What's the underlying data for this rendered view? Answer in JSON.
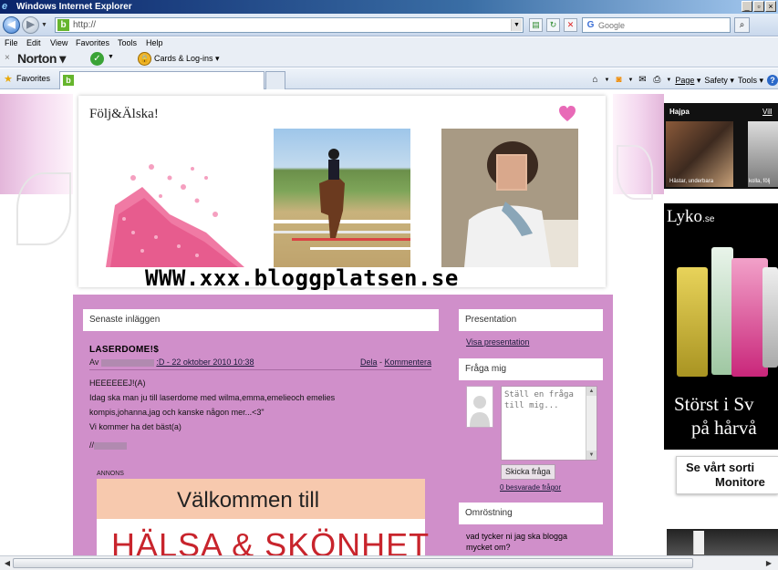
{
  "window": {
    "title": "Windows Internet Explorer"
  },
  "address": {
    "url": "http://",
    "search_placeholder": "Google"
  },
  "menu": [
    "File",
    "Edit",
    "View",
    "Favorites",
    "Tools",
    "Help"
  ],
  "norton": {
    "brand": "Norton",
    "cards": "Cards & Log-ins"
  },
  "favorites": {
    "label": "Favorites"
  },
  "commandbar": {
    "page": "Page",
    "safety": "Safety",
    "tools": "Tools"
  },
  "blog": {
    "title": "Följ&Älska!",
    "url": "WWW.xxx.bloggplatsen.se"
  },
  "main": {
    "latest_heading": "Senaste inläggen",
    "post": {
      "title": "LASERDOME!$",
      "meta_prefix": "Av",
      "meta_suffix": ":D - 22 oktober 2010 10:38",
      "share": "Dela",
      "sep": " - ",
      "comment": "Kommentera",
      "body": [
        "HEEEEEEJ!(A)",
        "Idag ska man ju till laserdome med wilma,emma,emelieoch emelies",
        "kompis,johanna,jag och kanske någon mer...<3\"",
        "Vi kommer ha det bäst(a)"
      ],
      "sign": "//"
    },
    "ad_label": "ANNONS",
    "ad_top": "Välkommen till",
    "ad_bottom": "HÄLSA & SKÖNHET"
  },
  "sidebar": {
    "presentation_heading": "Presentation",
    "presentation_link": "Visa presentation",
    "ask_heading": "Fråga mig",
    "ask_placeholder": "Ställ en fråga till mig...",
    "ask_button": "Skicka fråga",
    "answered_link": "0 besvarade frågor",
    "poll_heading": "Omröstning",
    "poll_question": "vad tycker ni jag ska blogga mycket om?"
  },
  "ads": {
    "hajpa_label": "Hajpa",
    "hajpa_more": "Vill",
    "hajpa_caption1": "Hästar, underbara",
    "hajpa_caption2": "kolla, följ",
    "lyko_logo": "Lyko",
    "lyko_tld": ".se",
    "lyko_line1": "Störst i Sv",
    "lyko_line2": "på hårvå",
    "sort_line1": "Se vårt sorti",
    "sort_line2": "Monitore"
  }
}
